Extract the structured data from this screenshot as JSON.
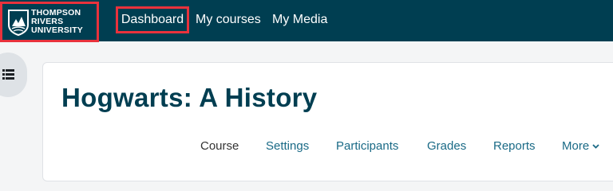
{
  "logo": {
    "line1": "THOMPSON",
    "line2": "RIVERS",
    "line3": "UNIVERSITY"
  },
  "nav": {
    "items": [
      {
        "label": "Dashboard"
      },
      {
        "label": "My courses"
      },
      {
        "label": "My Media"
      }
    ]
  },
  "drawer": {
    "icon": "list-icon"
  },
  "course": {
    "title": "Hogwarts: A History",
    "tabs": [
      {
        "label": "Course",
        "active": true
      },
      {
        "label": "Settings"
      },
      {
        "label": "Participants"
      },
      {
        "label": "Grades"
      },
      {
        "label": "Reports"
      },
      {
        "label": "More",
        "icon": "chevron-down-icon"
      }
    ]
  },
  "colors": {
    "navbar": "#003e51",
    "highlight": "#e8323c",
    "link": "#1a6a86",
    "title": "#003e51"
  }
}
